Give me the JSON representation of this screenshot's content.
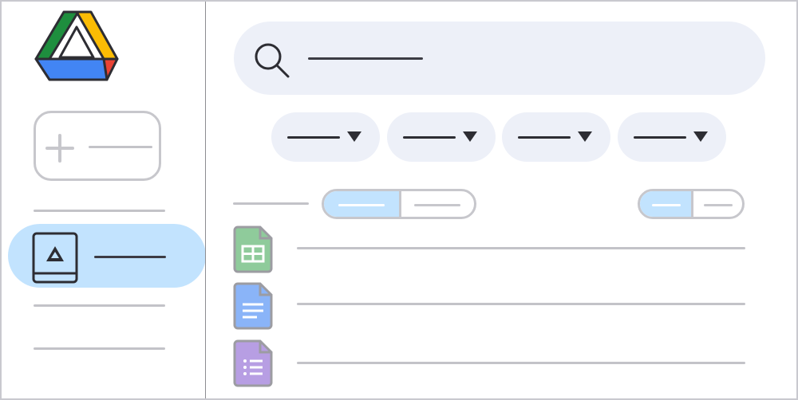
{
  "app": {
    "name": "Google Drive",
    "colors": {
      "accent_active": "#c2e3fe",
      "chip_bg": "#edf0f8",
      "drive_green": "#1e8e3e",
      "drive_yellow": "#fbbc04",
      "drive_blue": "#4285f4",
      "drive_red": "#ea4335",
      "sheets_green": "#8fcb9b",
      "docs_blue": "#8ab4f8",
      "forms_purple": "#b79ee3"
    }
  },
  "sidebar": {
    "logo": "google-drive-logo",
    "new_button": {
      "icon": "plus-icon",
      "label": ""
    },
    "items": [
      {
        "name": "my-drive",
        "icon": "drive-folder-icon",
        "label": "",
        "active": true
      },
      {
        "name": "placeholder-1",
        "label": ""
      },
      {
        "name": "placeholder-2",
        "label": ""
      }
    ]
  },
  "search": {
    "icon": "search-icon",
    "placeholder": ""
  },
  "filters": [
    {
      "label": "",
      "icon": "caret-down-icon"
    },
    {
      "label": "",
      "icon": "caret-down-icon"
    },
    {
      "label": "",
      "icon": "caret-down-icon"
    },
    {
      "label": "",
      "icon": "caret-down-icon"
    }
  ],
  "toolbar": {
    "heading": "",
    "view_toggle_left": {
      "options": [
        "",
        ""
      ],
      "selected": 0
    },
    "view_toggle_right": {
      "options": [
        "",
        ""
      ],
      "selected": 0
    }
  },
  "files": [
    {
      "type": "spreadsheet",
      "icon": "sheets-file-icon",
      "name": ""
    },
    {
      "type": "document",
      "icon": "docs-file-icon",
      "name": ""
    },
    {
      "type": "form",
      "icon": "forms-file-icon",
      "name": ""
    }
  ]
}
